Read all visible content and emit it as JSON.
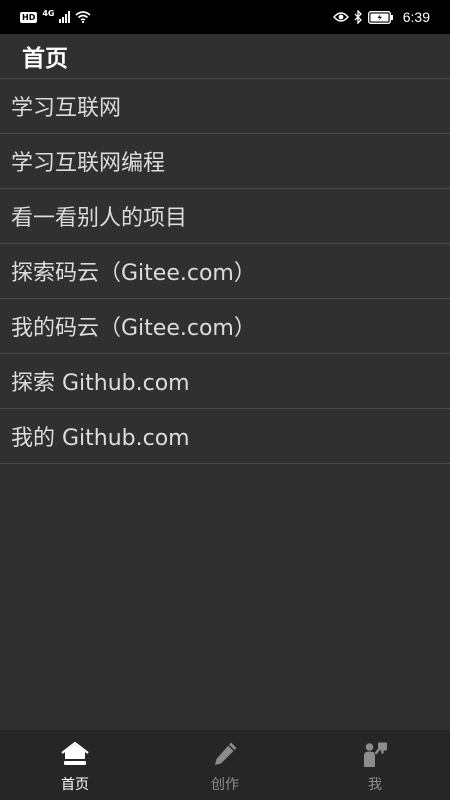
{
  "status_bar": {
    "hd": "HD",
    "net_type": "4G",
    "clock": "6:39"
  },
  "header": {
    "title": "首页"
  },
  "menu": {
    "items": [
      {
        "label": "学习互联网"
      },
      {
        "label": "学习互联网编程"
      },
      {
        "label": "看一看别人的项目"
      },
      {
        "label": "探索码云（Gitee.com）"
      },
      {
        "label": "我的码云（Gitee.com）"
      },
      {
        "label": "探索 Github.com"
      },
      {
        "label": "我的 Github.com"
      }
    ]
  },
  "bottom_nav": {
    "tabs": [
      {
        "label": "首页",
        "icon": "home-icon",
        "active": true
      },
      {
        "label": "创作",
        "icon": "pencil-icon",
        "active": false
      },
      {
        "label": "我",
        "icon": "user-icon",
        "active": false
      }
    ]
  },
  "colors": {
    "background": "#303030",
    "status_bar": "#000000",
    "bottom_nav": "#262626",
    "text": "#dcdcdc",
    "inactive_tab": "#8c8c8c",
    "active_tab": "#ffffff"
  }
}
